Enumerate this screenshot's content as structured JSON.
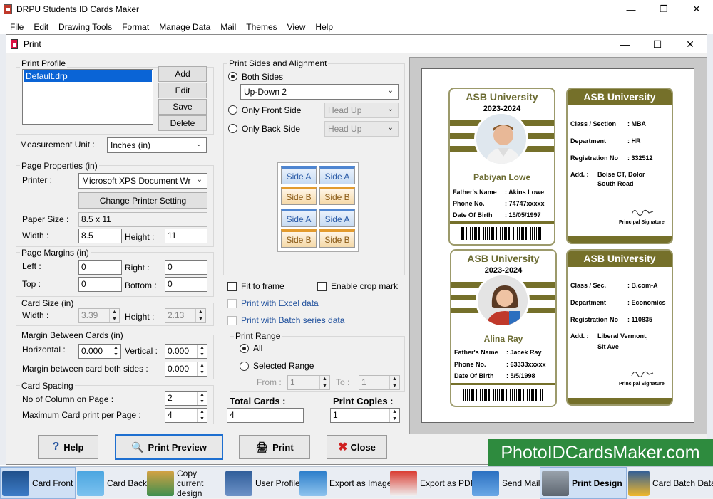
{
  "app": {
    "title": "DRPU Students ID Cards Maker",
    "win_min": "—",
    "win_max": "❐",
    "win_close": "✕"
  },
  "menu": [
    "File",
    "Edit",
    "Drawing Tools",
    "Format",
    "Manage Data",
    "Mail",
    "Themes",
    "View",
    "Help"
  ],
  "dialog": {
    "title": "Print",
    "min": "—",
    "max": "☐",
    "close": "✕"
  },
  "print_profile": {
    "label": "Print Profile",
    "items": [
      "Default.drp"
    ],
    "add": "Add",
    "edit": "Edit",
    "save": "Save",
    "delete": "Delete"
  },
  "measurement": {
    "label": "Measurement Unit :",
    "value": "Inches (in)"
  },
  "page_properties": {
    "label": "Page Properties (in)",
    "printer_label": "Printer :",
    "printer_value": "Microsoft XPS Document Wr",
    "change_printer": "Change Printer Setting",
    "paper_label": "Paper Size :",
    "paper_value": "8.5 x 11",
    "width_label": "Width :",
    "width_value": "8.5",
    "height_label": "Height :",
    "height_value": "11"
  },
  "page_margins": {
    "label": "Page Margins (in)",
    "left_label": "Left :",
    "left_value": "0",
    "right_label": "Right :",
    "right_value": "0",
    "top_label": "Top :",
    "top_value": "0",
    "bottom_label": "Bottom :",
    "bottom_value": "0"
  },
  "card_size": {
    "label": "Card Size (in)",
    "width_label": "Width :",
    "width_value": "3.39",
    "height_label": "Height :",
    "height_value": "2.13"
  },
  "margin_cards": {
    "label": "Margin Between Cards (in)",
    "horizontal_label": "Horizontal :",
    "horizontal_value": "0.000",
    "vertical_label": "Vertical :",
    "vertical_value": "0.000",
    "both_label": "Margin between card both sides :",
    "both_value": "0.000"
  },
  "card_spacing": {
    "label": "Card Spacing",
    "columns_label": "No of Column on Page :",
    "columns_value": "2",
    "max_label": "Maximum Card print per Page :",
    "max_value": "4"
  },
  "print_sides": {
    "label": "Print Sides and Alignment",
    "both": "Both Sides",
    "both_value": "Up-Down 2",
    "front": "Only Front Side",
    "front_value": "Head Up",
    "back": "Only Back Side",
    "back_value": "Head Up",
    "side_a": "Side A",
    "side_b": "Side B"
  },
  "options": {
    "fit_frame": "Fit to frame",
    "crop_mark": "Enable crop mark",
    "excel": "Print with Excel data",
    "batch": "Print with Batch series data"
  },
  "print_range": {
    "label": "Print Range",
    "all": "All",
    "selected": "Selected Range",
    "from_label": "From :",
    "from_value": "1",
    "to_label": "To :",
    "to_value": "1"
  },
  "totals": {
    "total_label": "Total Cards :",
    "total_value": "4",
    "copies_label": "Print Copies :",
    "copies_value": "1"
  },
  "cards": [
    {
      "university": "ASB University",
      "year": "2023-2024",
      "name": "Pabiyan Lowe",
      "father_label": "Father's Name",
      "father_value": ": Akins  Lowe",
      "phone_label": "Phone No.",
      "phone_value": ": 74747xxxxx",
      "dob_label": "Date Of Birth",
      "dob_value": ": 15/05/1997"
    },
    {
      "university": "ASB University",
      "year": "2023-2024",
      "name": "Alina Ray",
      "father_label": "Father's Name",
      "father_value": ": Jacek Ray",
      "phone_label": "Phone No.",
      "phone_value": ": 63333xxxxx",
      "dob_label": "Date Of Birth",
      "dob_value": ": 5/5/1998"
    }
  ],
  "backs": [
    {
      "university": "ASB University",
      "class_label": "Class / Section",
      "class_value": ": MBA",
      "dept_label": "Department",
      "dept_value": ": HR",
      "reg_label": "Registration No",
      "reg_value": ": 332512",
      "add_label": "Add. :",
      "add_line1": "Boise CT, Dolor",
      "add_line2": "South Road",
      "signature": "Principal Signature"
    },
    {
      "university": "ASB University",
      "class_label": "Class / Sec.",
      "class_value": ": B.com-A",
      "dept_label": "Department",
      "dept_value": ": Economics",
      "reg_label": "Registration No",
      "reg_value": ": 110835",
      "add_label": "Add. :",
      "add_line1": "Liberal Vermont,",
      "add_line2": "Sit Ave",
      "signature": "Principal Signature"
    }
  ],
  "bottom": {
    "help": "Help",
    "preview": "Print Preview",
    "print": "Print",
    "close": "Close",
    "brand": "PhotoIDCardsMaker.com"
  },
  "taskbar": [
    {
      "label": "Card Front"
    },
    {
      "label": "Card Back"
    },
    {
      "label": "Copy current design"
    },
    {
      "label": "User Profile"
    },
    {
      "label": "Export as Image"
    },
    {
      "label": "Export as PDF"
    },
    {
      "label": "Send Mail"
    },
    {
      "label": "Print Design"
    },
    {
      "label": "Card Batch Data"
    }
  ],
  "colors": {
    "accent": "#75702a",
    "brand": "#2e8b3e",
    "link": "#1e4f9c"
  }
}
